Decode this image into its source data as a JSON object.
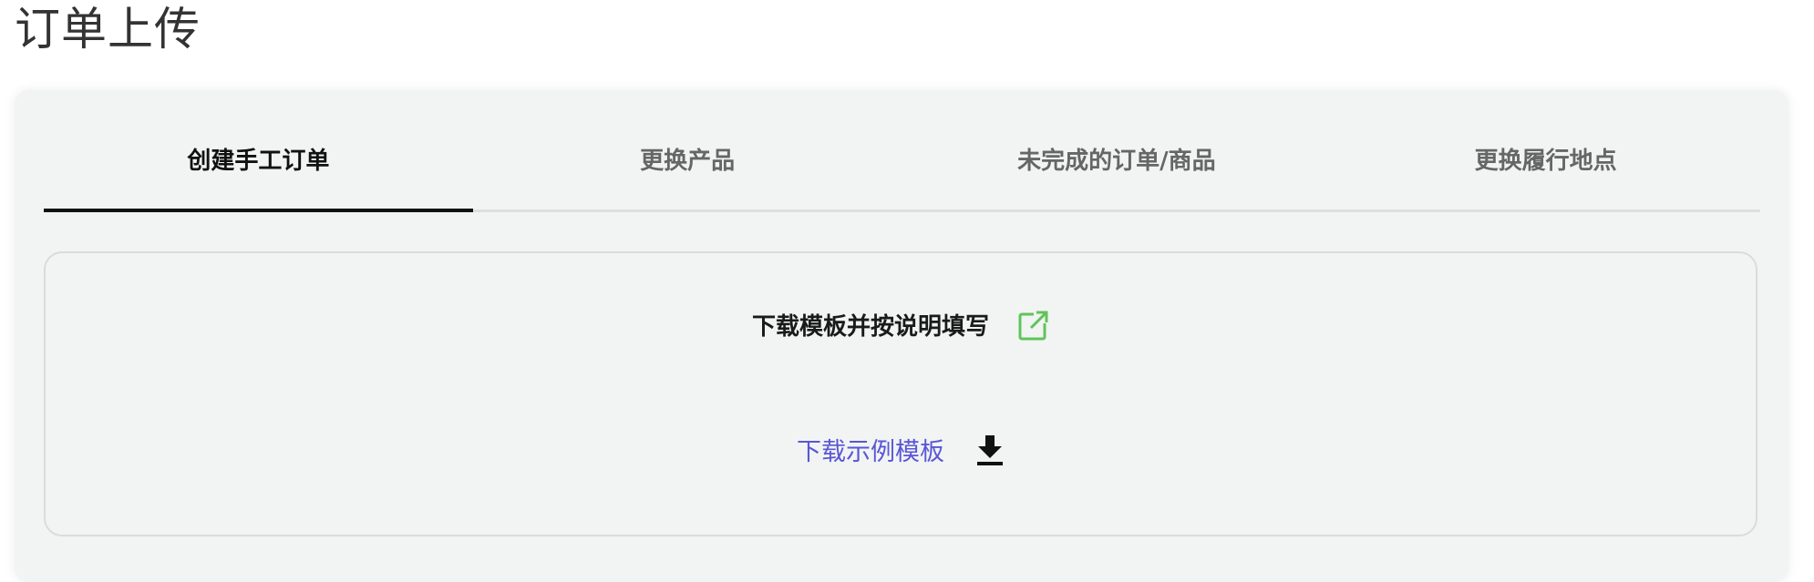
{
  "page": {
    "title": "订单上传"
  },
  "tabs": [
    {
      "label": "创建手工订单",
      "active": true
    },
    {
      "label": "更换产品",
      "active": false
    },
    {
      "label": "未完成的订单/商品",
      "active": false
    },
    {
      "label": "更换履行地点",
      "active": false
    }
  ],
  "panel": {
    "instruction": "下载模板并按说明填写",
    "instruction_icon": "external-link-icon",
    "download_label": "下载示例模板",
    "download_icon": "download-icon"
  },
  "colors": {
    "link": "#5a56d6",
    "external_link_icon": "#5fc45a",
    "card_background": "#f1f4f3",
    "active_tab_indicator": "#111111"
  }
}
